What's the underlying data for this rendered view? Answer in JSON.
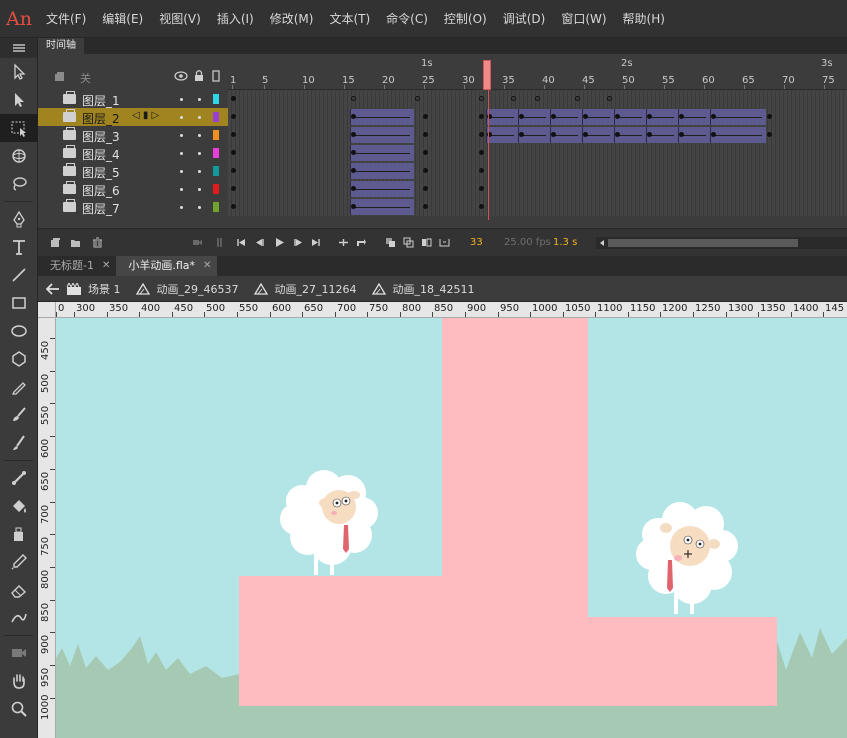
{
  "app": {
    "logo": "An"
  },
  "menu": [
    "文件(F)",
    "编辑(E)",
    "视图(V)",
    "插入(I)",
    "修改(M)",
    "文本(T)",
    "命令(C)",
    "控制(O)",
    "调试(D)",
    "窗口(W)",
    "帮助(H)"
  ],
  "timeline": {
    "tab": "时间轴",
    "header_label": "关",
    "second_labels": [
      "1s",
      "2s",
      "3s"
    ],
    "frame_numbers": [
      "1",
      "5",
      "10",
      "15",
      "20",
      "25",
      "30",
      "35",
      "40",
      "45",
      "50",
      "55",
      "60",
      "65",
      "70",
      "75"
    ],
    "current_frame": "33",
    "fps": "25.00 fps",
    "elapsed": "1.3 s",
    "layers": [
      {
        "name": "图层_1",
        "color": "#2fd6e8",
        "selected": false
      },
      {
        "name": "图层_2",
        "color": "#9b3fd0",
        "selected": true
      },
      {
        "name": "图层_3",
        "color": "#f0901f",
        "selected": false
      },
      {
        "name": "图层_4",
        "color": "#e93fd8",
        "selected": false
      },
      {
        "name": "图层_5",
        "color": "#0f9b9b",
        "selected": false
      },
      {
        "name": "图层_6",
        "color": "#e01b1b",
        "selected": false
      },
      {
        "name": "图层_7",
        "color": "#6fa32b",
        "selected": false
      }
    ]
  },
  "documents": {
    "tabs": [
      {
        "label": "无标题-1",
        "active": false
      },
      {
        "label": "小羊动画.fla*",
        "active": true
      }
    ]
  },
  "editbar": {
    "crumbs": [
      "场景 1",
      "动画_29_46537",
      "动画_27_11264",
      "动画_18_42511"
    ]
  },
  "rulers": {
    "horizontal": [
      "0",
      "300",
      "350",
      "400",
      "450",
      "500",
      "550",
      "600",
      "650",
      "700",
      "750",
      "800",
      "850",
      "900",
      "950",
      "1000",
      "1050",
      "1100",
      "1150",
      "1200",
      "1250",
      "1300",
      "1350",
      "1400",
      "145"
    ],
    "vertical": [
      "450",
      "500",
      "550",
      "600",
      "650",
      "700",
      "750",
      "800",
      "850",
      "900",
      "950",
      "1000"
    ]
  },
  "stage": {
    "sky_color": "#b3e5e6",
    "platform_color": "#ffbcc0",
    "grass_color": "#a6c9b4"
  }
}
